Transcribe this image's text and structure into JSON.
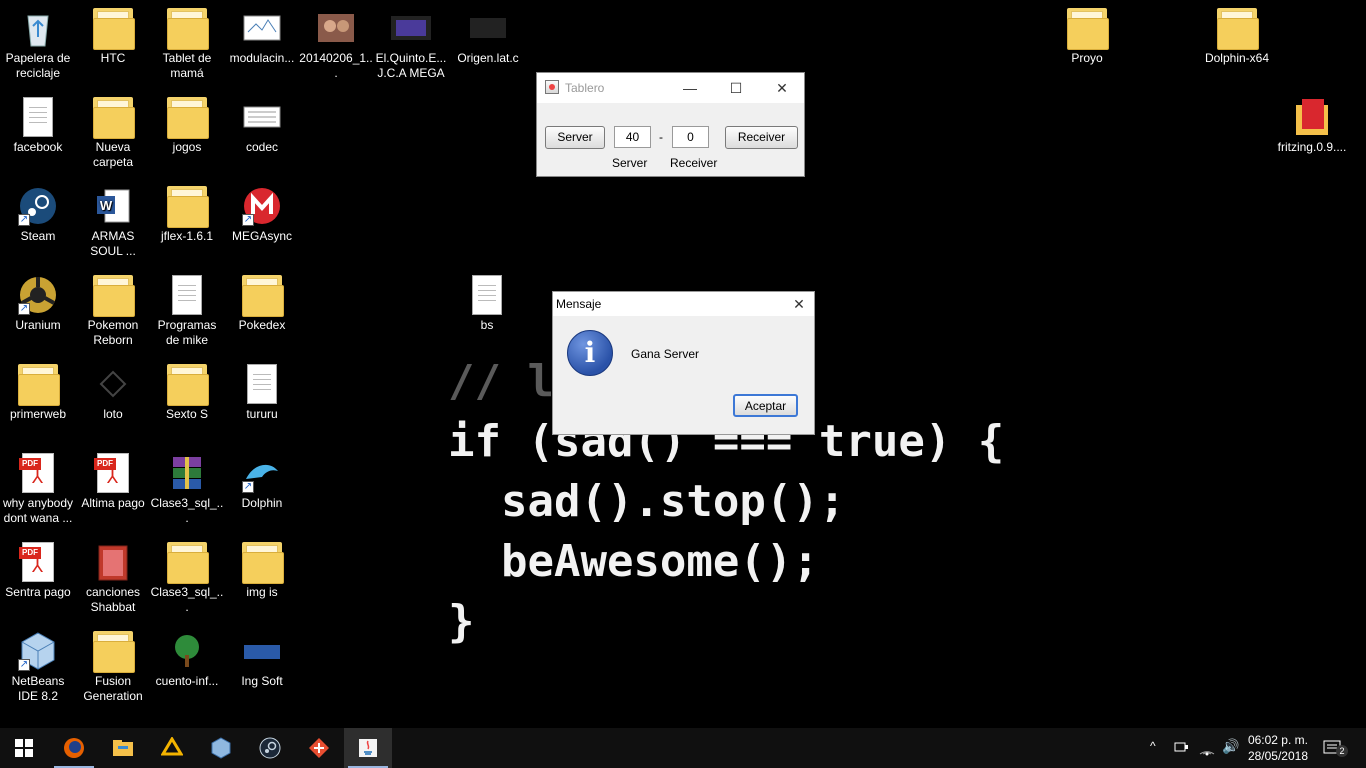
{
  "desktop": {
    "icons": [
      {
        "label": "Papelera de reciclaje",
        "icon": "recycle-bin-icon"
      },
      {
        "label": "HTC",
        "icon": "folder-icon"
      },
      {
        "label": "Tablet de mamá",
        "icon": "folder-icon"
      },
      {
        "label": "modulacin...",
        "icon": "image-file-icon"
      },
      {
        "label": "20140206_1...",
        "icon": "photo-file-icon"
      },
      {
        "label": "El.Quinto.E... J.C.A MEGA",
        "icon": "video-file-icon"
      },
      {
        "label": "Origen.lat.c",
        "icon": "video-file-icon"
      },
      {
        "label": "facebook",
        "icon": "text-file-icon"
      },
      {
        "label": "Nueva carpeta",
        "icon": "folder-icon"
      },
      {
        "label": "jogos",
        "icon": "folder-icon"
      },
      {
        "label": "codec",
        "icon": "image-file-icon"
      },
      {
        "label": "Steam",
        "icon": "steam-icon"
      },
      {
        "label": "ARMAS SOUL ...",
        "icon": "word-document-icon"
      },
      {
        "label": "jflex-1.6.1",
        "icon": "folder-icon"
      },
      {
        "label": "MEGAsync",
        "icon": "megasync-icon"
      },
      {
        "label": "Uranium",
        "icon": "uranium-icon"
      },
      {
        "label": "Pokemon Reborn",
        "icon": "folder-icon"
      },
      {
        "label": "Programas de mike",
        "icon": "text-file-icon"
      },
      {
        "label": "Pokedex",
        "icon": "folder-icon"
      },
      {
        "label": "primerweb",
        "icon": "firefox-folder-icon"
      },
      {
        "label": "loto",
        "icon": "file-icon"
      },
      {
        "label": "Sexto S",
        "icon": "pdf-folder-icon"
      },
      {
        "label": "tururu",
        "icon": "text-file-icon"
      },
      {
        "label": "why anybody dont wana ...",
        "icon": "pdf-icon"
      },
      {
        "label": "Altima pago",
        "icon": "pdf-icon"
      },
      {
        "label": "Clase3_sql_...",
        "icon": "winrar-icon"
      },
      {
        "label": "Dolphin",
        "icon": "dolphin-icon"
      },
      {
        "label": "Sentra pago",
        "icon": "pdf-icon"
      },
      {
        "label": "canciones Shabbat",
        "icon": "folder-icon"
      },
      {
        "label": "Clase3_sql_...",
        "icon": "folder-icon"
      },
      {
        "label": "img is",
        "icon": "folder-icon"
      },
      {
        "label": "NetBeans IDE 8.2",
        "icon": "netbeans-icon"
      },
      {
        "label": "Fusion Generation",
        "icon": "folder-icon"
      },
      {
        "label": "cuento-inf...",
        "icon": "tree-icon"
      },
      {
        "label": "Ing Soft",
        "icon": "image-file-icon"
      },
      {
        "label": "Proyo",
        "icon": "folder-icon"
      },
      {
        "label": "Dolphin-x64",
        "icon": "folder-icon"
      },
      {
        "label": "fritzing.0.9....",
        "icon": "folder-icon"
      },
      {
        "label": "bs",
        "icon": "text-file-icon"
      }
    ],
    "wallpaper_lines": [
      "// li",
      "if (sad() === true) {",
      "  sad().stop();",
      "  beAwesome();",
      "}"
    ]
  },
  "tablero": {
    "title": "Tablero",
    "minimize": "—",
    "maximize": "☐",
    "close": "✕",
    "server_button": "Server",
    "server_score": "40",
    "separator": "-",
    "receiver_score": "0",
    "receiver_button": "Receiver",
    "server_label": "Server",
    "receiver_label": "Receiver"
  },
  "mensaje": {
    "title": "Mensaje",
    "close": "✕",
    "icon_glyph": "i",
    "message": "Gana Server",
    "ok_button": "Aceptar"
  },
  "taskbar": {
    "items": [
      "start-icon",
      "firefox-icon",
      "file-explorer-icon",
      "google-drive-icon",
      "virtualbox-icon",
      "steam-icon",
      "git-icon",
      "java-icon"
    ],
    "tray_chevron": "^",
    "volume_glyph": "🔊",
    "time": "06:02 p. m.",
    "date": "28/05/2018",
    "notifications": "2"
  },
  "colors": {
    "desktop_bg": "#000000",
    "taskbar_bg": "#101010",
    "accent": "#3d78d6"
  }
}
